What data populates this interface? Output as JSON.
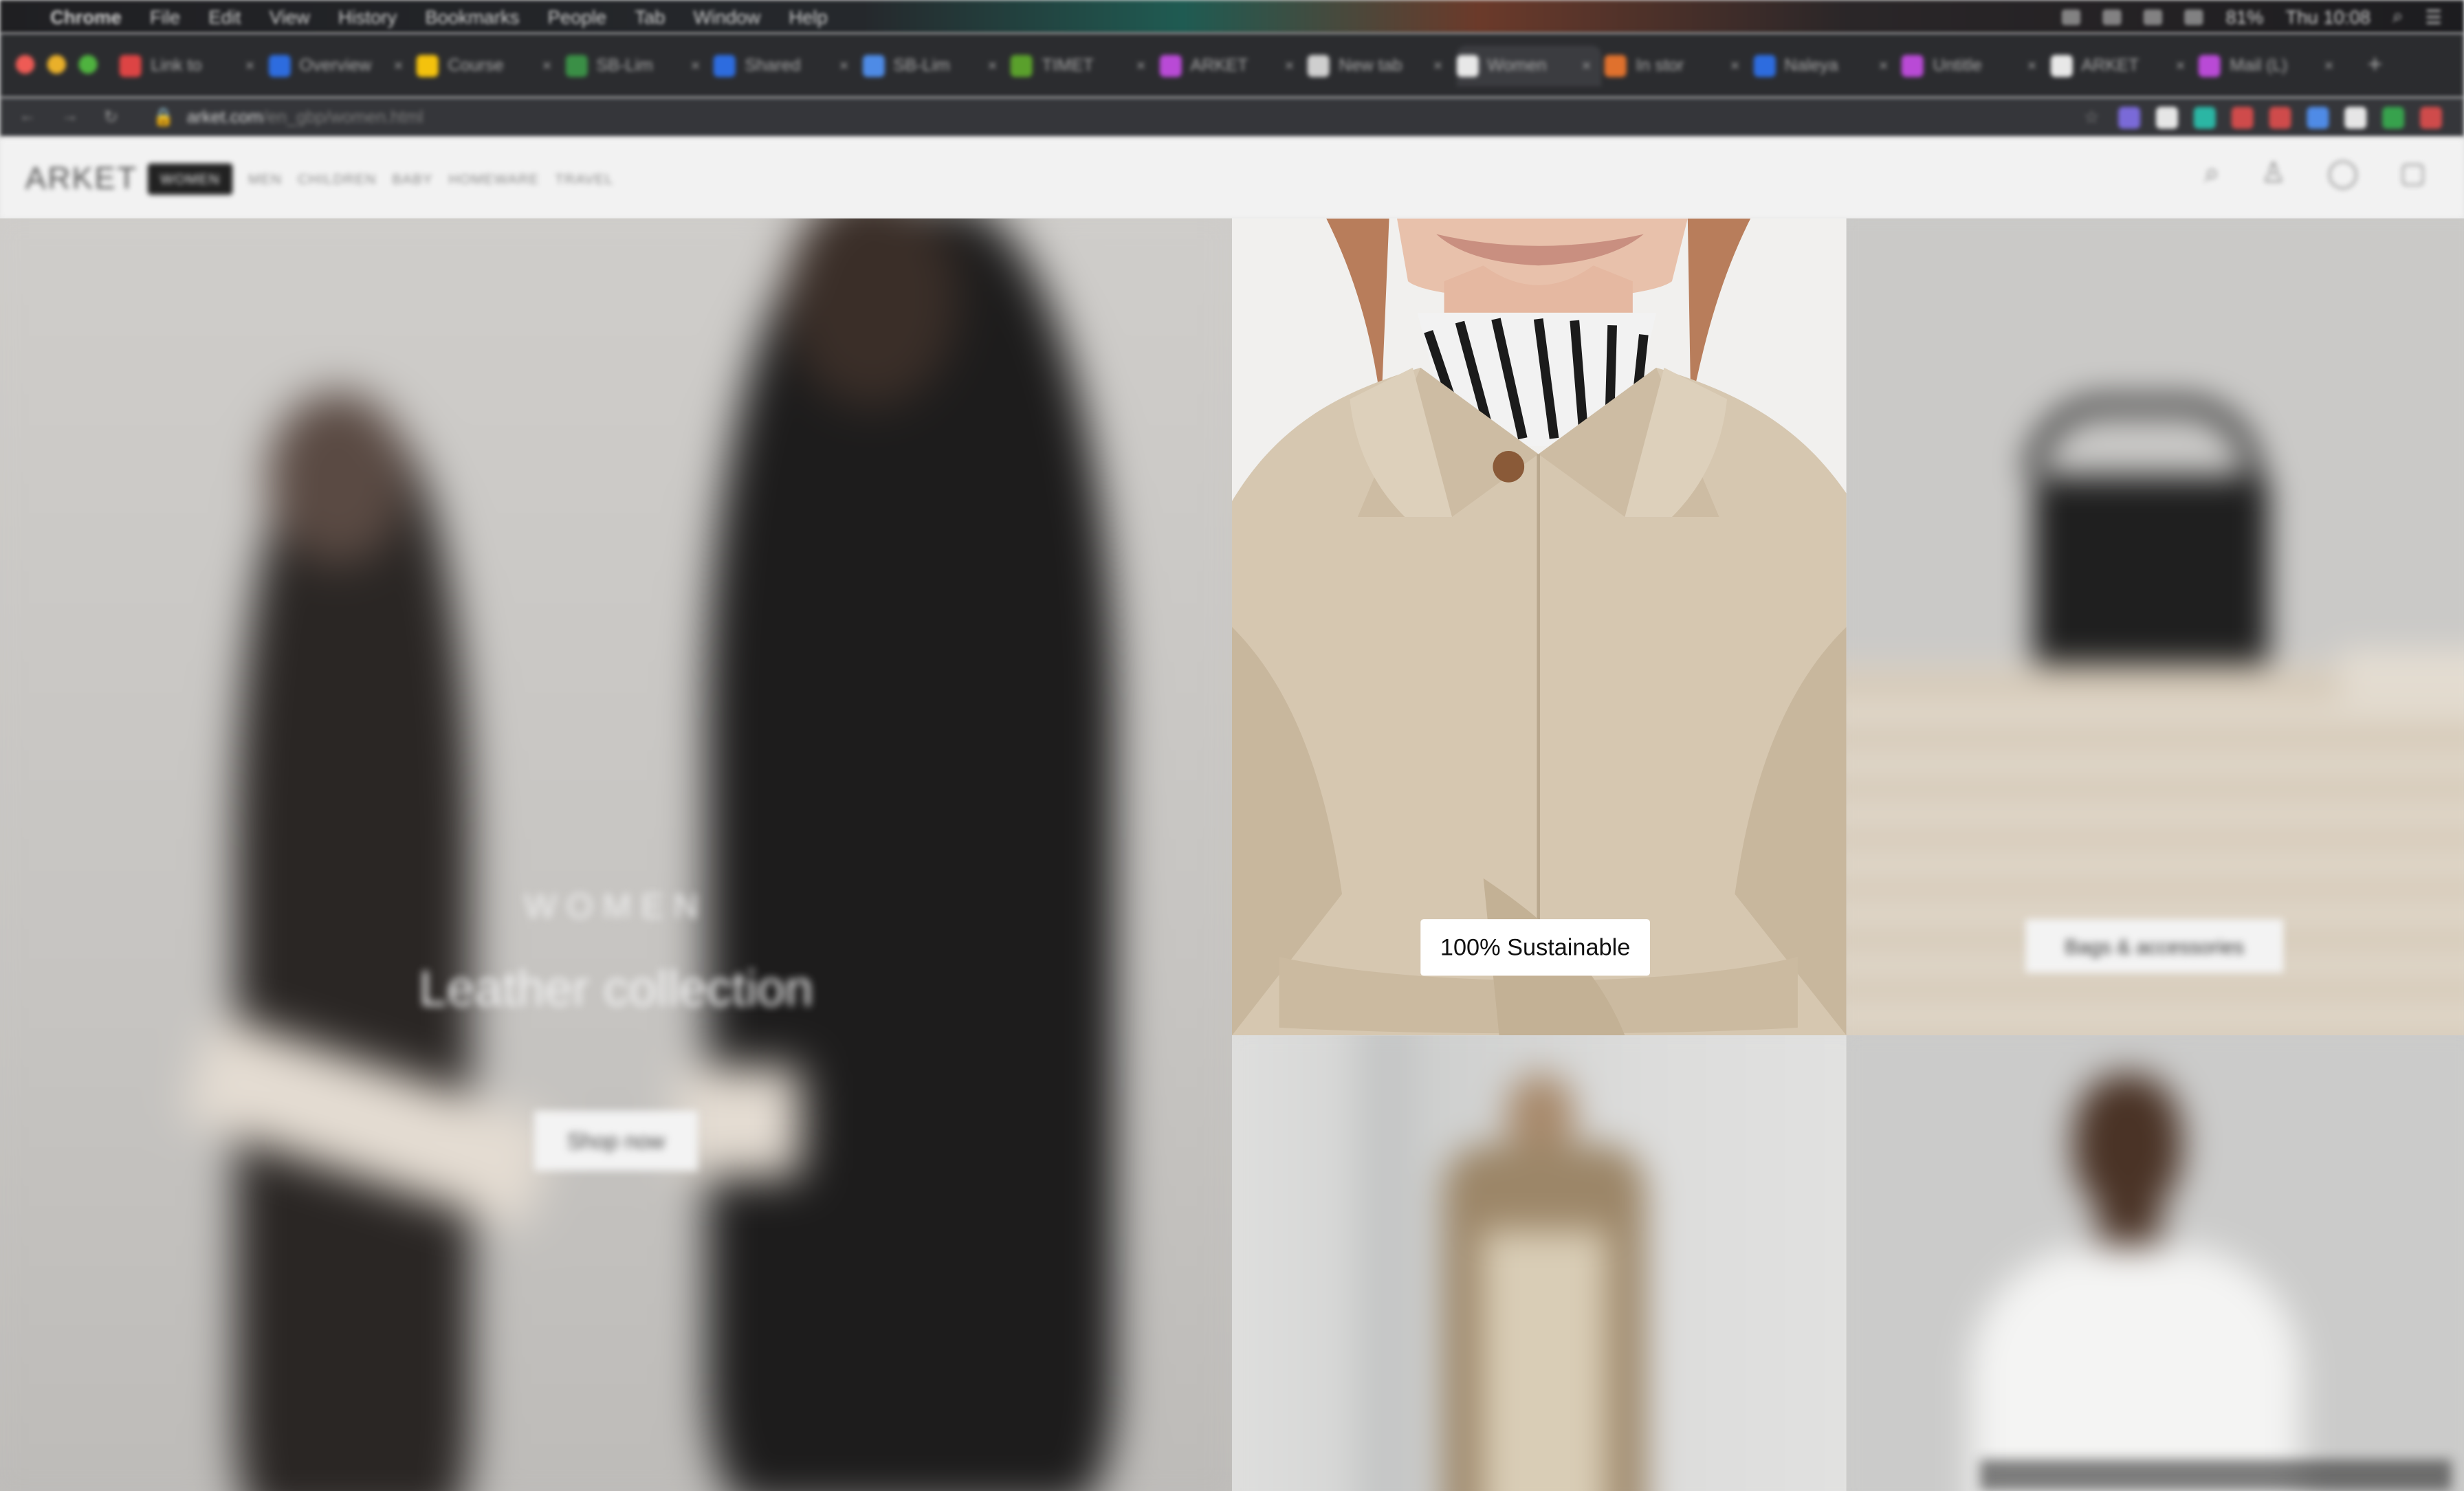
{
  "menubar": {
    "apple": "",
    "items": [
      "Chrome",
      "File",
      "Edit",
      "View",
      "History",
      "Bookmarks",
      "People",
      "Tab",
      "Window",
      "Help"
    ],
    "battery": "81%",
    "clock": "Thu 10:08"
  },
  "tabs": [
    {
      "title": "Link to",
      "color": "#d44"
    },
    {
      "title": "Overview",
      "color": "#2d6cdf"
    },
    {
      "title": "Course",
      "color": "#f4c20d"
    },
    {
      "title": "SB-Lim",
      "color": "#3a8f46"
    },
    {
      "title": "Shared",
      "color": "#2d6cdf"
    },
    {
      "title": "SB-Lim",
      "color": "#4e8be6"
    },
    {
      "title": "TIMET",
      "color": "#5aa02c"
    },
    {
      "title": "ARKET",
      "color": "#b94ad6"
    },
    {
      "title": "New tab",
      "color": "#cfcfcf"
    },
    {
      "title": "Women",
      "color": "#e8e8e8",
      "active": true
    },
    {
      "title": "In stor",
      "color": "#e0712d"
    },
    {
      "title": "Naleya",
      "color": "#2d6cdf"
    },
    {
      "title": "Untitle",
      "color": "#b94ad6"
    },
    {
      "title": "ARKET",
      "color": "#e8e8e8"
    },
    {
      "title": "Mail (L)",
      "color": "#b94ad6"
    }
  ],
  "toolbar": {
    "url_domain": "arket.com",
    "url_path": "/en_gbp/women.html",
    "extensions": [
      "#7a6ad8",
      "#e6e6e6",
      "#2bb6a4",
      "#cf4b4b",
      "#cf4b4b",
      "#4f8be6",
      "#e6e6e6",
      "#37a24d",
      "#cf4b4b"
    ]
  },
  "site": {
    "logo": "ARKET",
    "nav": [
      "WOMEN",
      "MEN",
      "CHILDREN",
      "BABY",
      "HOMEWARE",
      "TRAVEL"
    ],
    "active_nav": "WOMEN",
    "icons": [
      "search-icon",
      "account-icon",
      "favourites-icon",
      "bag-icon"
    ]
  },
  "hero": {
    "eyebrow": "WOMEN",
    "title": "Leather collection",
    "cta": "Shop now"
  },
  "tiles": {
    "coat_label": "100% Sustainable",
    "bag_label": "Bags & accessories"
  }
}
